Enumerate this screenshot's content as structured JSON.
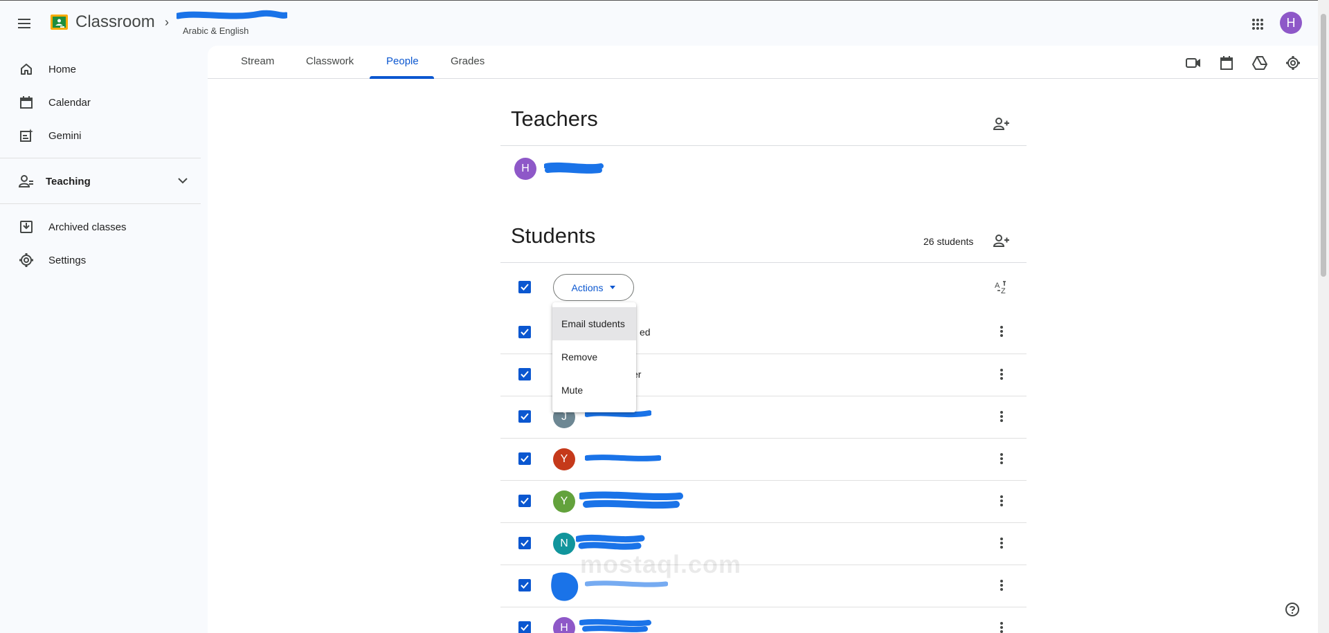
{
  "app": {
    "title": "Classroom"
  },
  "breadcrumb": {
    "class_subtitle": "Arabic & English"
  },
  "profile": {
    "initial": "H",
    "color": "#8e58c8"
  },
  "sidebar": {
    "items": [
      {
        "label": "Home",
        "icon": "home-icon"
      },
      {
        "label": "Calendar",
        "icon": "calendar-icon"
      },
      {
        "label": "Gemini",
        "icon": "gemini-icon"
      },
      {
        "label": "Teaching",
        "icon": "teaching-icon"
      },
      {
        "label": "Archived classes",
        "icon": "archive-icon"
      },
      {
        "label": "Settings",
        "icon": "gear-icon"
      }
    ]
  },
  "tabs": [
    {
      "label": "Stream"
    },
    {
      "label": "Classwork"
    },
    {
      "label": "People",
      "active": true
    },
    {
      "label": "Grades"
    }
  ],
  "teachers": {
    "title": "Teachers",
    "list": [
      {
        "initial": "H",
        "color": "#8e58c8"
      }
    ]
  },
  "students": {
    "title": "Students",
    "count_label": "26 students",
    "actions_label": "Actions",
    "rows": [
      {
        "initial": "",
        "color": "",
        "partial_name": "ed"
      },
      {
        "initial": "",
        "color": "",
        "partial_name": "er"
      },
      {
        "initial": "J",
        "color": "#6d8793"
      },
      {
        "initial": "Y",
        "color": "#c5391a"
      },
      {
        "initial": "Y",
        "color": "#63a23c"
      },
      {
        "initial": "N",
        "color": "#11959c"
      },
      {
        "initial": "",
        "color": "#1a73e8"
      },
      {
        "initial": "H",
        "color": "#8e58c8"
      }
    ]
  },
  "actions_menu": {
    "items": [
      {
        "label": "Email students",
        "highlighted": true
      },
      {
        "label": "Remove"
      },
      {
        "label": "Mute"
      }
    ]
  },
  "watermark": {
    "text": "mostaql.com"
  },
  "colors": {
    "accent": "#0b57d0",
    "redaction": "#1a73e8"
  }
}
